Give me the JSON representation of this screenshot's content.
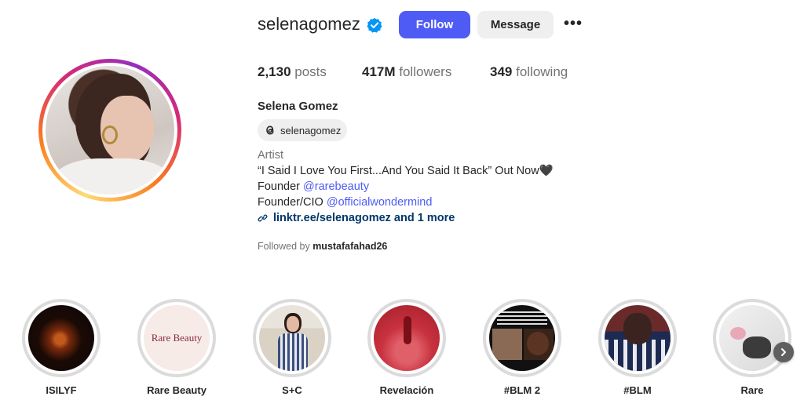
{
  "profile": {
    "username": "selenagomez",
    "full_name": "Selena Gomez",
    "threads_handle": "selenagomez",
    "category": "Artist",
    "bio_line1": "“I Said I Love You First...And You Said It Back” Out Now🖤",
    "bio_founder_prefix": "Founder ",
    "bio_founder_link": "@rarebeauty",
    "bio_cio_prefix": "Founder/CIO ",
    "bio_cio_link": "@officialwondermind",
    "external_link": "linktr.ee/selenagomez and 1 more",
    "followed_by_prefix": "Followed by ",
    "followed_by_user": "mustafafahad26"
  },
  "actions": {
    "follow_label": "Follow",
    "message_label": "Message",
    "more_label": "•••"
  },
  "stats": {
    "posts_count": "2,130",
    "posts_label": " posts",
    "followers_count": "417M",
    "followers_label": " followers",
    "following_count": "349",
    "following_label": " following"
  },
  "highlights": [
    {
      "label": "ISILYF"
    },
    {
      "label": "Rare Beauty",
      "cover_text": "Rare Beauty"
    },
    {
      "label": "S+C"
    },
    {
      "label": "Revelación"
    },
    {
      "label": "#BLM 2"
    },
    {
      "label": "#BLM"
    },
    {
      "label": "Rare"
    }
  ],
  "colors": {
    "follow_button": "#4f5bf5",
    "link_blue": "#4f5bf5",
    "link_dark": "#00376b",
    "verified_badge": "#0095f6"
  },
  "icons": {
    "verified": "verified-badge-icon",
    "threads": "threads-icon",
    "link": "link-icon",
    "more": "more-options-icon",
    "next": "chevron-right-icon"
  }
}
